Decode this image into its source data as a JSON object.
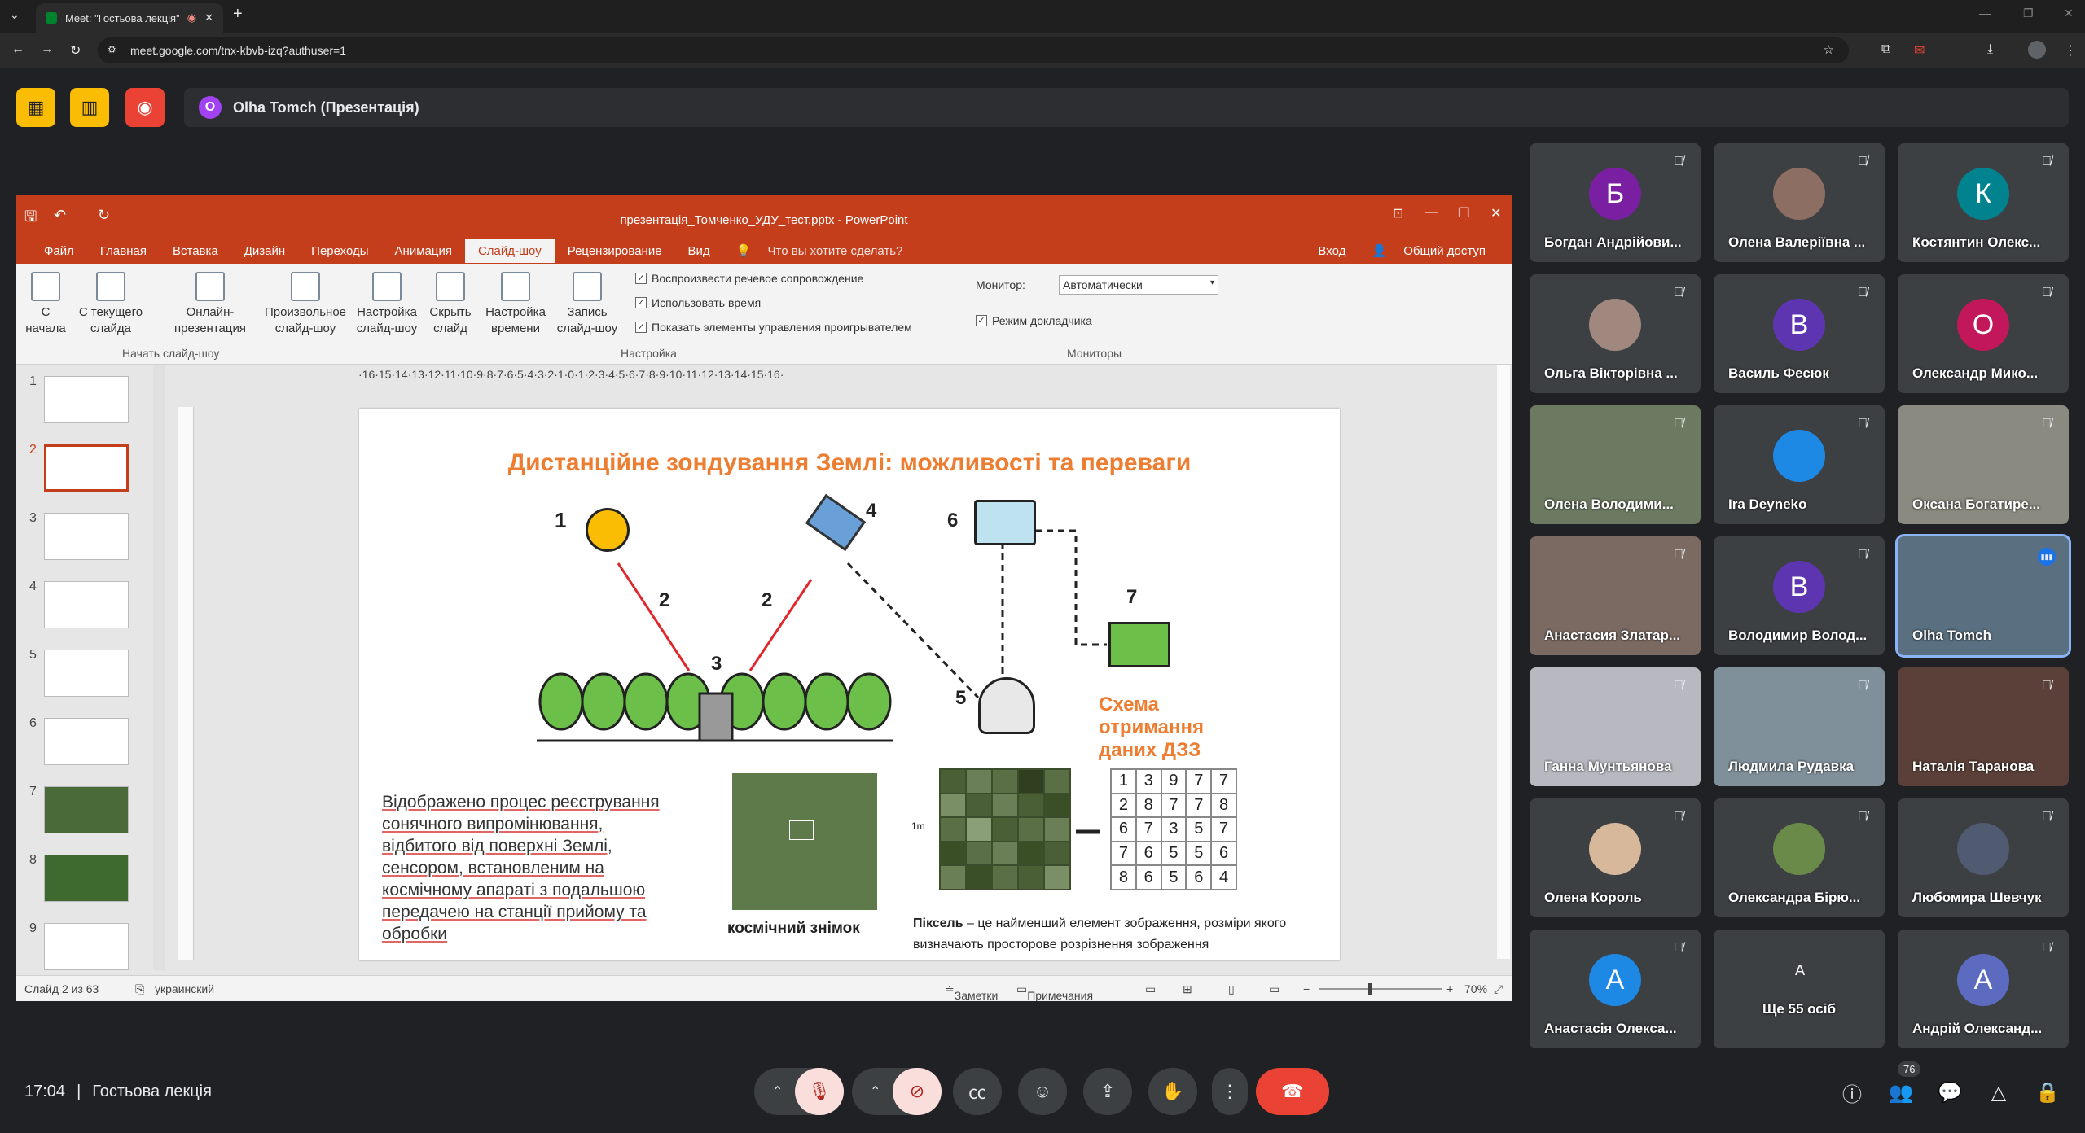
{
  "browser": {
    "tab_title": "Meet: \"Гостьова лекція\"",
    "new_tab": "+",
    "url": "meet.google.com/tnx-kbvb-izq?authuser=1"
  },
  "meet_header": {
    "presenter_initial": "O",
    "presenter_label": "Olha Tomch (Презентація)"
  },
  "ppt": {
    "title": "презентація_Томченко_УДУ_тест.pptx - PowerPoint",
    "tabs": [
      "Файл",
      "Главная",
      "Вставка",
      "Дизайн",
      "Переходы",
      "Анимация",
      "Слайд-шоу",
      "Рецензирование",
      "Вид"
    ],
    "tell_me": "Что вы хотите сделать?",
    "login": "Вход",
    "share": "Общий доступ",
    "ribbon": {
      "from_start": "С начала",
      "from_current": "С текущего слайда",
      "online": "Онлайн-презентация",
      "custom": "Произвольное слайд-шоу",
      "group_start": "Начать слайд-шоу",
      "setup": "Настройка слайд-шоу",
      "hide": "Скрыть слайд",
      "rehearse": "Настройка времени",
      "record": "Запись слайд-шоу",
      "chk_narration": "Воспроизвести речевое сопровождение",
      "chk_timings": "Использовать время",
      "chk_controls": "Показать элементы управления проигрывателем",
      "group_setup": "Настройка",
      "monitor_label": "Монитор:",
      "monitor_value": "Автоматически",
      "presenter_view": "Режим докладчика",
      "group_monitors": "Мониторы"
    },
    "thumb_numbers": [
      "1",
      "2",
      "3",
      "4",
      "5",
      "6",
      "7",
      "8",
      "9"
    ],
    "ruler": "·16·15·14·13·12·11·10·9·8·7·6·5·4·3·2·1·0·1·2·3·4·5·6·7·8·9·10·11·12·13·14·15·16·",
    "status": {
      "slide": "Слайд 2 из 63",
      "lang": "украинский",
      "notes": "Заметки",
      "comments": "Примечания",
      "zoom": "70%"
    },
    "slide": {
      "title": "Дистанційне зондування Землі: можливості та переваги",
      "labels": [
        "1",
        "2",
        "2",
        "3",
        "4",
        "5",
        "6",
        "7"
      ],
      "scheme": "Схема отримання даних ДЗЗ",
      "body": "Відображено процес реєстрування сонячного випромінювання, відбитого від поверхні Землі, сенсором, встановленим на космічному апараті з подальшою передачею на станції прийому та обробки",
      "sat_caption": "космічний знімок",
      "scale": "1m",
      "pixel_bold": "Піксель",
      "pixel_text": " – це найменший елемент зображення, розміри якого визначають просторове розрізнення зображення",
      "grid_values": [
        [
          "1",
          "3",
          "9",
          "7",
          "7"
        ],
        [
          "2",
          "8",
          "7",
          "7",
          "8"
        ],
        [
          "6",
          "7",
          "3",
          "5",
          "7"
        ],
        [
          "7",
          "6",
          "5",
          "5",
          "6"
        ],
        [
          "8",
          "6",
          "5",
          "6",
          "4"
        ]
      ]
    }
  },
  "participants": [
    {
      "name": "Богдан Андрійови...",
      "initial": "Б",
      "color": "#7b1fa2",
      "type": "avatar"
    },
    {
      "name": "Олена Валеріївна ...",
      "initial": "",
      "color": "#8d6e63",
      "type": "photo"
    },
    {
      "name": "Костянтин Олекс...",
      "initial": "К",
      "color": "#00838f",
      "type": "avatar"
    },
    {
      "name": "Ольга Вікторівна ...",
      "initial": "",
      "color": "#a1887f",
      "type": "photo"
    },
    {
      "name": "Василь Фесюк",
      "initial": "В",
      "color": "#5e35b1",
      "type": "avatar"
    },
    {
      "name": "Олександр Мико...",
      "initial": "О",
      "color": "#c2185b",
      "type": "avatar"
    },
    {
      "name": "Олена Володими...",
      "initial": "",
      "color": "#6d7a62",
      "type": "video"
    },
    {
      "name": "Ira Deyneko",
      "initial": "",
      "color": "#1e88e5",
      "type": "photo"
    },
    {
      "name": "Оксана Богатире...",
      "initial": "",
      "color": "#8a8a80",
      "type": "video"
    },
    {
      "name": "Анастасия Златар...",
      "initial": "",
      "color": "#7a6a62",
      "type": "video"
    },
    {
      "name": "Володимир Волод...",
      "initial": "В",
      "color": "#5e35b1",
      "type": "avatar"
    },
    {
      "name": "Olha Tomch",
      "initial": "",
      "color": "#5a7080",
      "type": "video"
    },
    {
      "name": "Ганна Мунтьянова",
      "initial": "",
      "color": "#b8b8c0",
      "type": "video"
    },
    {
      "name": "Людмила Рудавка",
      "initial": "",
      "color": "#80909a",
      "type": "video"
    },
    {
      "name": "Наталія Таранова",
      "initial": "",
      "color": "#5a4038",
      "type": "video"
    },
    {
      "name": "Олена Король",
      "initial": "",
      "color": "#d7b89a",
      "type": "photo"
    },
    {
      "name": "Олександра Бірю...",
      "initial": "",
      "color": "#6a8a4a",
      "type": "photo"
    },
    {
      "name": "Любомира Шевчук",
      "initial": "",
      "color": "#505a70",
      "type": "photo"
    },
    {
      "name": "Анастасія Олекса...",
      "initial": "А",
      "color": "#1e88e5",
      "type": "avatar"
    },
    {
      "name": "Ще 55 осіб",
      "initial": "A",
      "color": "#4a4a4a",
      "type": "more"
    },
    {
      "name": "Андрій Олександ...",
      "initial": "А",
      "color": "#5c6bc0",
      "type": "avatar"
    }
  ],
  "bottom": {
    "time": "17:04",
    "meeting": "Гостьова лекція",
    "people_count": "76"
  }
}
